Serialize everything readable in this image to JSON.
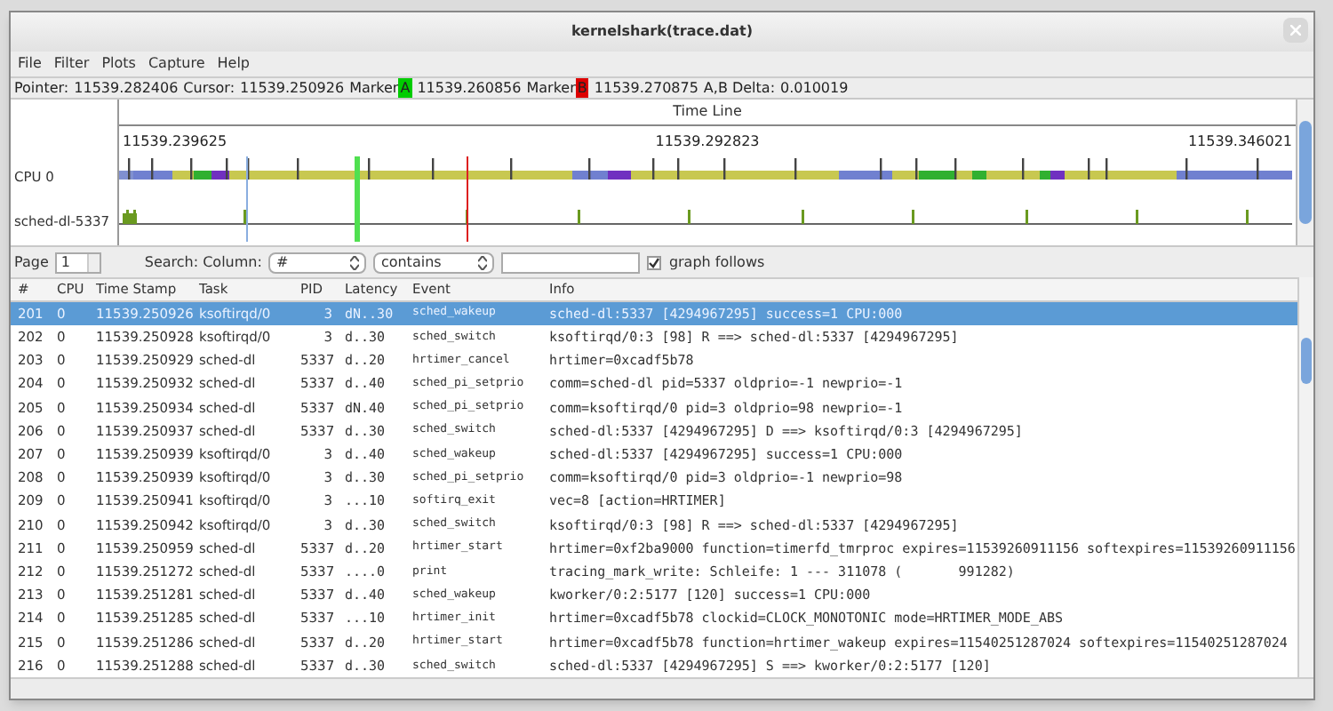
{
  "window": {
    "title": "kernelshark(trace.dat)"
  },
  "menu": [
    "File",
    "Filter",
    "Plots",
    "Capture",
    "Help"
  ],
  "pointer_bar": {
    "pointer_label": "Pointer:",
    "pointer": "11539.282406",
    "cursor_label": "Cursor:",
    "cursor": "11539.250926",
    "markers": [
      {
        "label": "Marker",
        "letter": "A",
        "color": "#00cc00",
        "time": "11539.260856"
      },
      {
        "label": "Marker",
        "letter": "B",
        "color": "#dd0000",
        "time": "11539.270875"
      }
    ],
    "delta_label": "A,B Delta:",
    "delta": "0.010019"
  },
  "graph": {
    "title": "Time Line",
    "ticks": [
      "11539.239625",
      "11539.292823",
      "11539.346021"
    ],
    "plots": [
      "CPU 0",
      "sched-dl-5337"
    ]
  },
  "search": {
    "page_label": "Page",
    "page": "1",
    "search_label": "Search: Column:",
    "column": "#",
    "operator": "contains",
    "graph_follows": {
      "label": "graph follows",
      "checked": true
    }
  },
  "table": {
    "columns": [
      "#",
      "CPU",
      "Time Stamp",
      "Task",
      "PID",
      "Latency",
      "Event",
      "Info"
    ],
    "rows": [
      {
        "selected": true,
        "cells": [
          "201",
          "0",
          "11539.250926",
          "ksoftirqd/0",
          "3",
          "dN..30",
          "sched_wakeup",
          "sched-dl:5337 [4294967295] success=1 CPU:000"
        ]
      },
      {
        "selected": false,
        "cells": [
          "202",
          "0",
          "11539.250928",
          "ksoftirqd/0",
          "3",
          "d..30",
          "sched_switch",
          "ksoftirqd/0:3 [98] R ==> sched-dl:5337 [4294967295]"
        ]
      },
      {
        "selected": false,
        "cells": [
          "203",
          "0",
          "11539.250929",
          "sched-dl",
          "5337",
          "d..20",
          "hrtimer_cancel",
          "hrtimer=0xcadf5b78"
        ]
      },
      {
        "selected": false,
        "cells": [
          "204",
          "0",
          "11539.250932",
          "sched-dl",
          "5337",
          "d..40",
          "sched_pi_setprio",
          "comm=sched-dl pid=5337 oldprio=-1 newprio=-1"
        ]
      },
      {
        "selected": false,
        "cells": [
          "205",
          "0",
          "11539.250934",
          "sched-dl",
          "5337",
          "dN.40",
          "sched_pi_setprio",
          "comm=ksoftirqd/0 pid=3 oldprio=98 newprio=-1"
        ]
      },
      {
        "selected": false,
        "cells": [
          "206",
          "0",
          "11539.250937",
          "sched-dl",
          "5337",
          "d..30",
          "sched_switch",
          "sched-dl:5337 [4294967295] D ==> ksoftirqd/0:3 [4294967295]"
        ]
      },
      {
        "selected": false,
        "cells": [
          "207",
          "0",
          "11539.250939",
          "ksoftirqd/0",
          "3",
          "d..40",
          "sched_wakeup",
          "sched-dl:5337 [4294967295] success=1 CPU:000"
        ]
      },
      {
        "selected": false,
        "cells": [
          "208",
          "0",
          "11539.250939",
          "ksoftirqd/0",
          "3",
          "d..30",
          "sched_pi_setprio",
          "comm=ksoftirqd/0 pid=3 oldprio=-1 newprio=98"
        ]
      },
      {
        "selected": false,
        "cells": [
          "209",
          "0",
          "11539.250941",
          "ksoftirqd/0",
          "3",
          "...10",
          "softirq_exit",
          "vec=8 [action=HRTIMER]"
        ]
      },
      {
        "selected": false,
        "cells": [
          "210",
          "0",
          "11539.250942",
          "ksoftirqd/0",
          "3",
          "d..30",
          "sched_switch",
          "ksoftirqd/0:3 [98] R ==> sched-dl:5337 [4294967295]"
        ]
      },
      {
        "selected": false,
        "cells": [
          "211",
          "0",
          "11539.250959",
          "sched-dl",
          "5337",
          "d..20",
          "hrtimer_start",
          "hrtimer=0xf2ba9000 function=timerfd_tmrproc expires=11539260911156 softexpires=11539260911156"
        ]
      },
      {
        "selected": false,
        "cells": [
          "212",
          "0",
          "11539.251272",
          "sched-dl",
          "5337",
          "....0",
          "print",
          "tracing_mark_write: Schleife: 1 --- 311078 (       991282)"
        ]
      },
      {
        "selected": false,
        "cells": [
          "213",
          "0",
          "11539.251281",
          "sched-dl",
          "5337",
          "d..40",
          "sched_wakeup",
          "kworker/0:2:5177 [120] success=1 CPU:000"
        ]
      },
      {
        "selected": false,
        "cells": [
          "214",
          "0",
          "11539.251285",
          "sched-dl",
          "5337",
          "...10",
          "hrtimer_init",
          "hrtimer=0xcadf5b78 clockid=CLOCK_MONOTONIC mode=HRTIMER_MODE_ABS"
        ]
      },
      {
        "selected": false,
        "cells": [
          "215",
          "0",
          "11539.251286",
          "sched-dl",
          "5337",
          "d..20",
          "hrtimer_start",
          "hrtimer=0xcadf5b78 function=hrtimer_wakeup expires=11540251287024 softexpires=11540251287024"
        ]
      },
      {
        "selected": false,
        "cells": [
          "216",
          "0",
          "11539.251288",
          "sched-dl",
          "5337",
          "d..30",
          "sched_switch",
          "sched-dl:5337 [4294967295] S ==> kworker/0:2:5177 [120]"
        ]
      }
    ]
  }
}
